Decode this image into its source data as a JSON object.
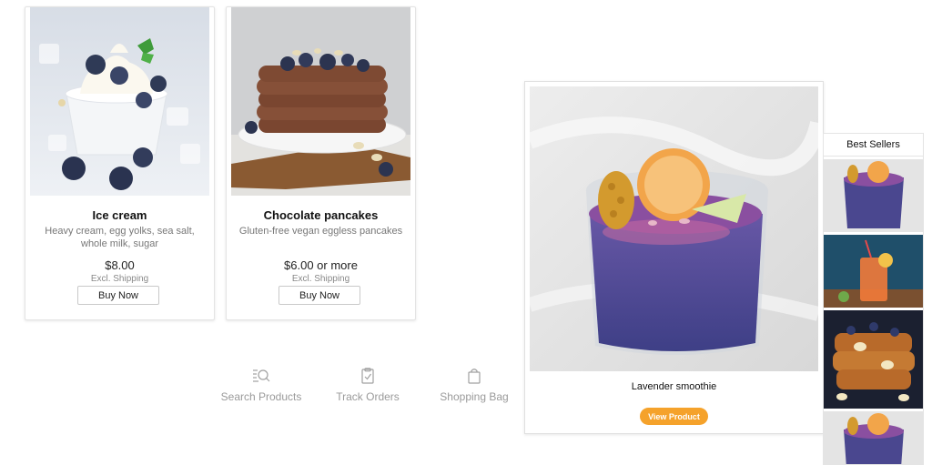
{
  "products": [
    {
      "name": "Ice cream",
      "description": "Heavy cream, egg yolks, sea salt, whole milk, sugar",
      "price": "$8.00",
      "shipping": "Excl. Shipping",
      "button": "Buy Now",
      "image_icon": "ice-cream-image"
    },
    {
      "name": "Chocolate pancakes",
      "description": "Gluten-free vegan eggless pancakes",
      "price": "$6.00 or more",
      "shipping": "Excl. Shipping",
      "button": "Buy Now",
      "image_icon": "pancakes-image"
    }
  ],
  "nav": [
    {
      "label": "Search Products",
      "icon": "search-list-icon"
    },
    {
      "label": "Track Orders",
      "icon": "clipboard-check-icon"
    },
    {
      "label": "Shopping Bag",
      "icon": "shopping-bag-icon"
    }
  ],
  "featured": {
    "name": "Lavender smoothie",
    "button": "View Product",
    "accent_color": "#f5a22b"
  },
  "best_sellers": {
    "title": "Best Sellers",
    "items": [
      "smoothie-thumb",
      "drink-thumb",
      "french-toast-thumb",
      "smoothie-thumb"
    ]
  }
}
